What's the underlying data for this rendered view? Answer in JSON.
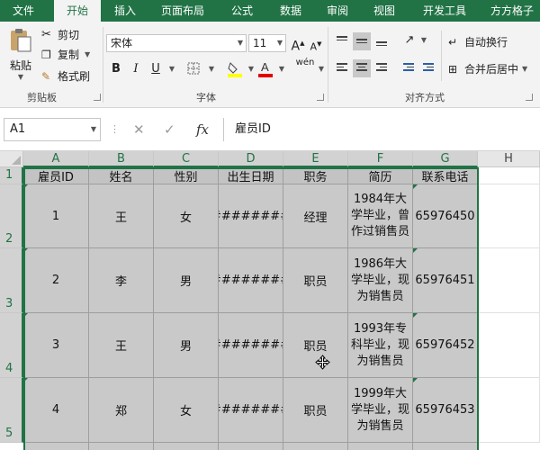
{
  "tabs": [
    "文件",
    "开始",
    "插入",
    "页面布局",
    "公式",
    "数据",
    "审阅",
    "视图",
    "开发工具",
    "方方格子"
  ],
  "active_tab": "开始",
  "clipboard": {
    "paste_label": "粘贴",
    "cut_label": "剪切",
    "copy_label": "复制",
    "format_painter_label": "格式刷",
    "group_label": "剪贴板"
  },
  "font": {
    "font_name": "宋体",
    "font_size": "11",
    "bold": "B",
    "italic": "I",
    "underline": "U",
    "grow": "A",
    "shrink": "A",
    "phonetic": "wén",
    "group_label": "字体"
  },
  "alignment": {
    "wrap_text_label": "自动换行",
    "merge_center_label": "合并后居中",
    "group_label": "对齐方式"
  },
  "formula_bar": {
    "name_box": "A1",
    "fx": "fx",
    "content": "雇员ID"
  },
  "grid": {
    "columns": [
      "A",
      "B",
      "C",
      "D",
      "E",
      "F",
      "G",
      "H"
    ],
    "rows": [
      "1",
      "2",
      "3",
      "4",
      "5"
    ],
    "header": [
      "雇员ID",
      "姓名",
      "性别",
      "出生日期",
      "职务",
      "简历",
      "联系电话"
    ],
    "data": [
      [
        "1",
        "王",
        "女",
        "########",
        "经理",
        "1984年大学毕业，曾作过销售员",
        "65976450"
      ],
      [
        "2",
        "李",
        "男",
        "########",
        "职员",
        "1986年大学毕业，现为销售员",
        "65976451"
      ],
      [
        "3",
        "王",
        "男",
        "########",
        "职员",
        "1993年专科毕业，现为销售员",
        "65976452"
      ],
      [
        "4",
        "郑",
        "女",
        "########",
        "职员",
        "1999年大学毕业，现为销售员",
        "65976453"
      ]
    ]
  },
  "colors": {
    "brand": "#217346",
    "selection_fill": "#c9c9c9"
  }
}
